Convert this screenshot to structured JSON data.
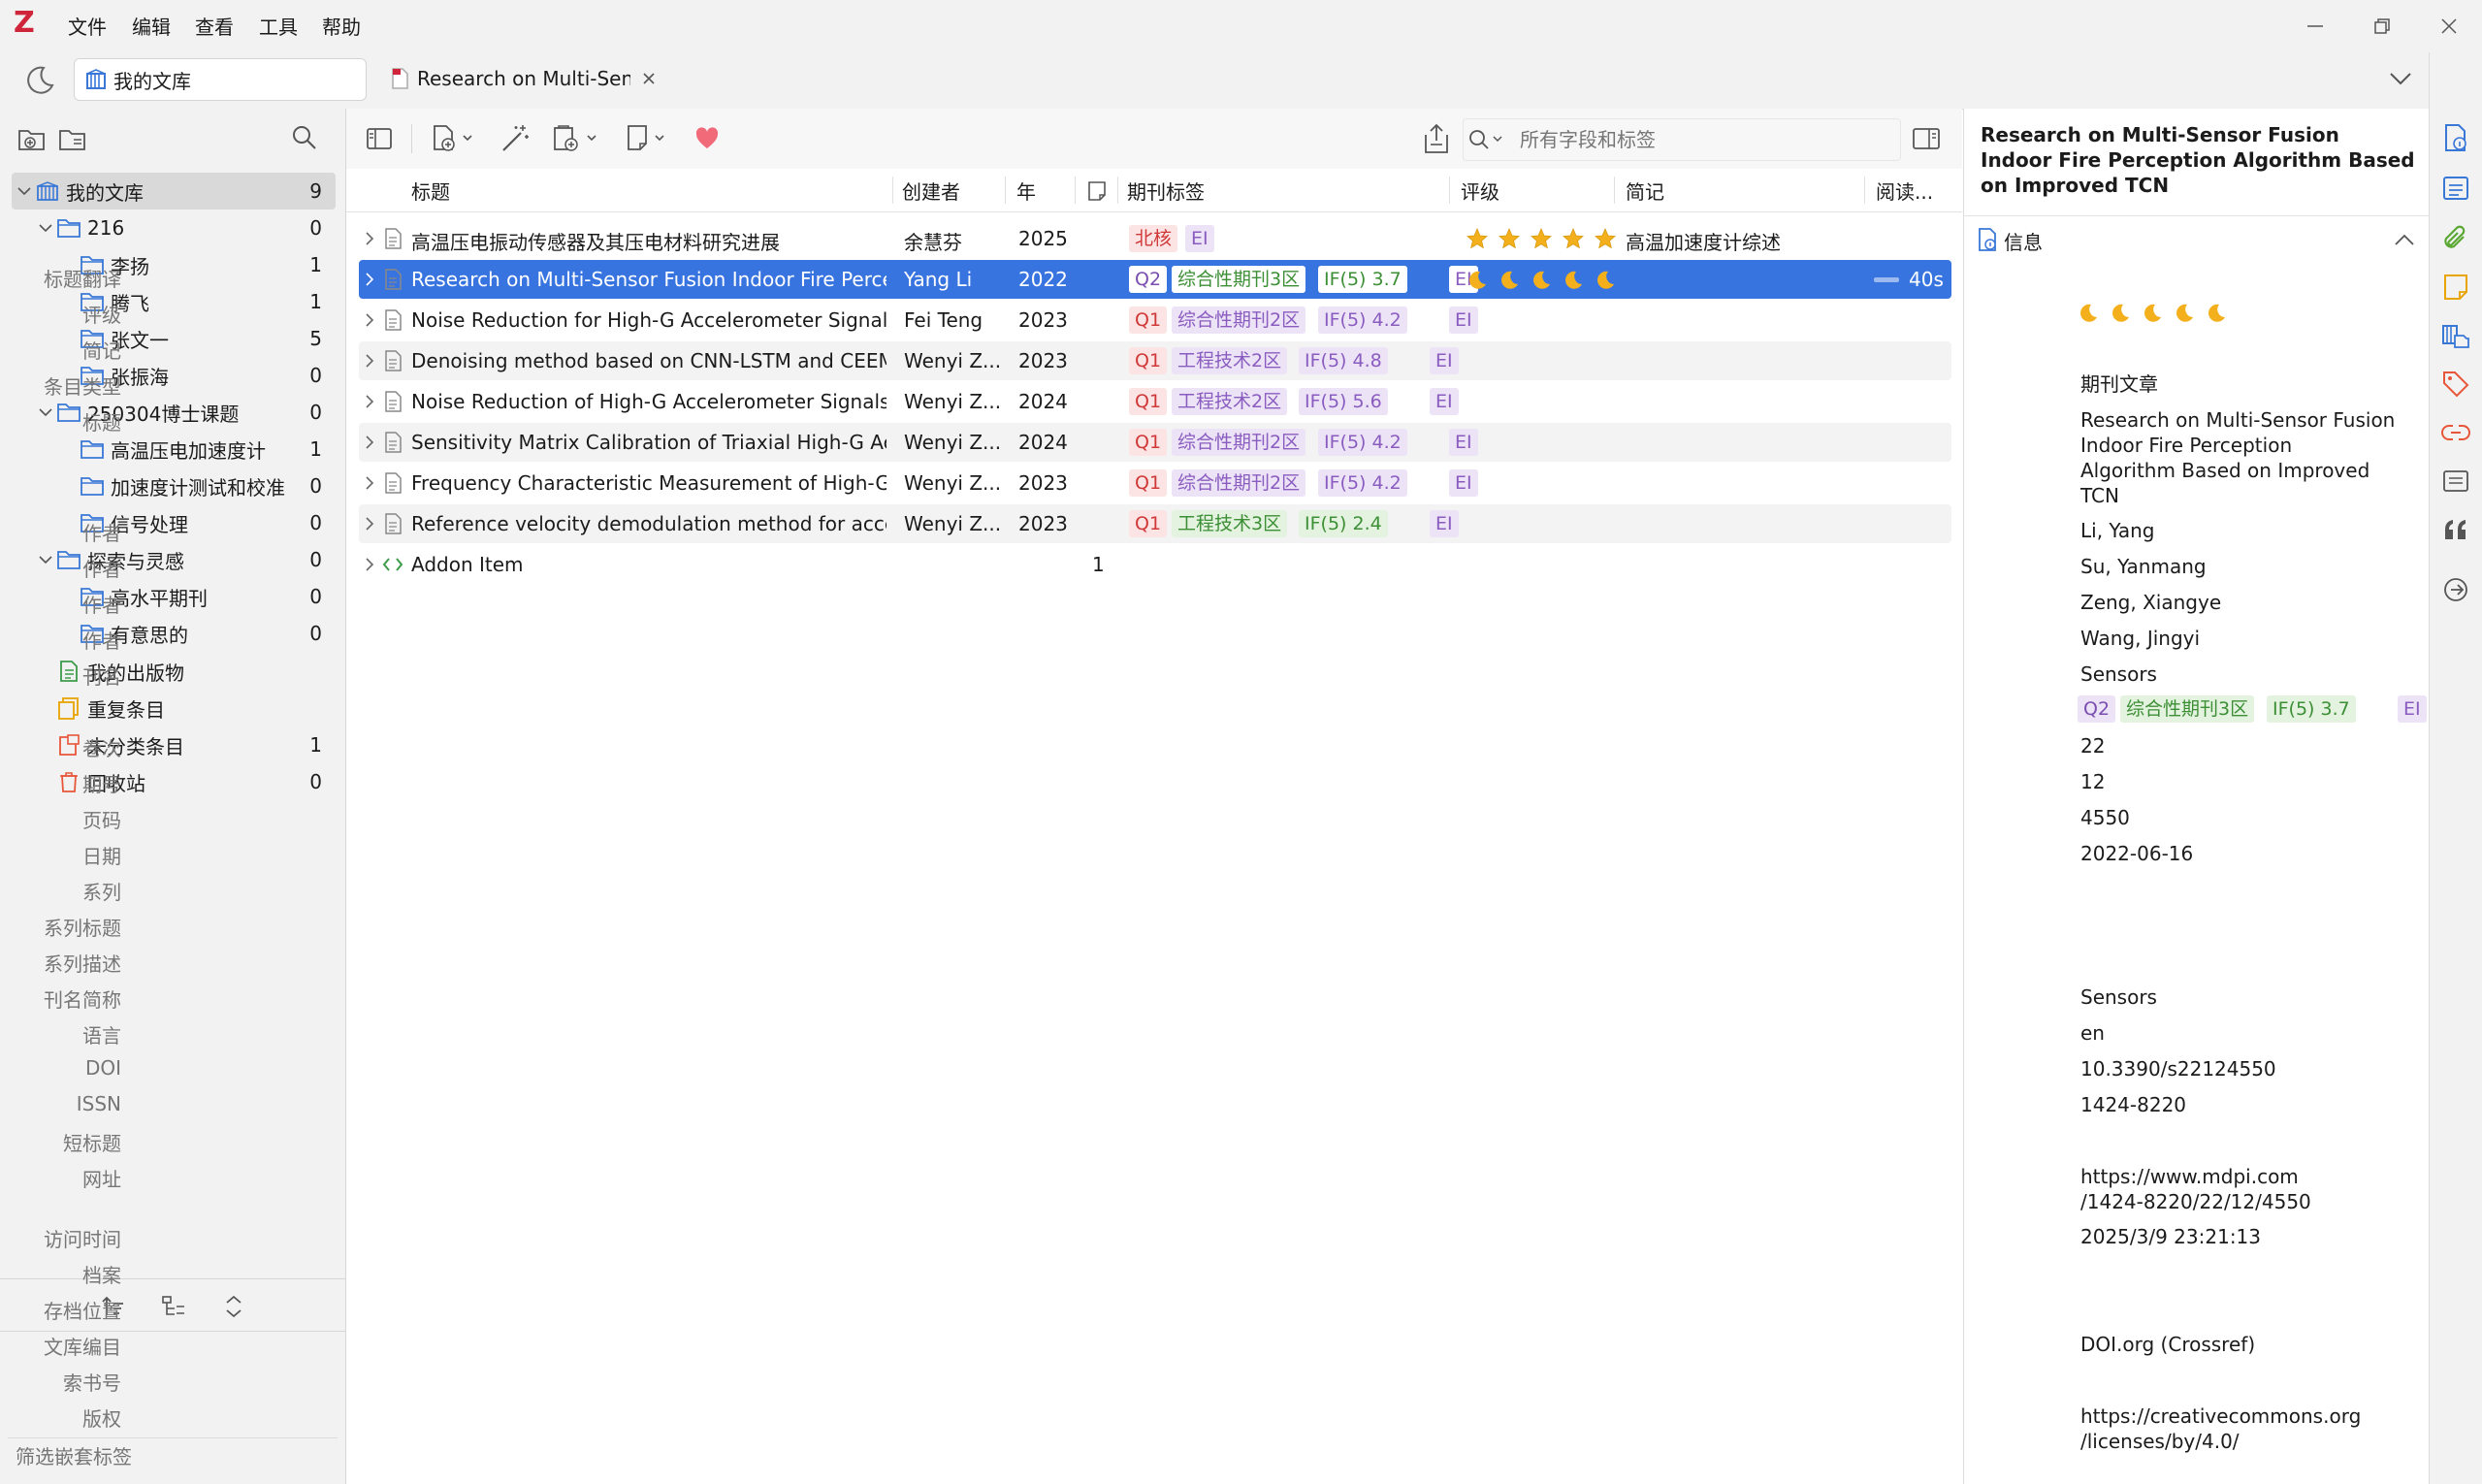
{
  "app": {
    "logo": "Z"
  },
  "menu": [
    "文件",
    "编辑",
    "查看",
    "工具",
    "帮助"
  ],
  "tabs": [
    {
      "label": "我的文库",
      "icon": "library-icon"
    },
    {
      "label": "Research on Multi-Sens",
      "icon": "pdf-icon"
    }
  ],
  "sidebar": {
    "collections": [
      {
        "name": "我的文库",
        "count": "9",
        "level": 0,
        "icon": "library-icon",
        "expanded": true,
        "selected": true
      },
      {
        "name": "216",
        "count": "0",
        "level": 1,
        "icon": "folder-icon",
        "expanded": true
      },
      {
        "name": "李扬",
        "count": "1",
        "level": 2,
        "icon": "folder-icon"
      },
      {
        "name": "腾飞",
        "count": "1",
        "level": 2,
        "icon": "folder-icon"
      },
      {
        "name": "张文一",
        "count": "5",
        "level": 2,
        "icon": "folder-icon"
      },
      {
        "name": "张振海",
        "count": "0",
        "level": 2,
        "icon": "folder-icon"
      },
      {
        "name": "250304博士课题",
        "count": "0",
        "level": 1,
        "icon": "folder-icon",
        "expanded": true
      },
      {
        "name": "高温压电加速度计",
        "count": "1",
        "level": 2,
        "icon": "folder-icon"
      },
      {
        "name": "加速度计测试和校准",
        "count": "0",
        "level": 2,
        "icon": "folder-icon"
      },
      {
        "name": "信号处理",
        "count": "0",
        "level": 2,
        "icon": "folder-icon"
      },
      {
        "name": "探索与灵感",
        "count": "0",
        "level": 1,
        "icon": "folder-icon",
        "expanded": true
      },
      {
        "name": "高水平期刊",
        "count": "0",
        "level": 2,
        "icon": "folder-icon"
      },
      {
        "name": "有意思的",
        "count": "0",
        "level": 2,
        "icon": "folder-icon"
      },
      {
        "name": "我的出版物",
        "count": "",
        "level": 1,
        "icon": "publications-icon"
      },
      {
        "name": "重复条目",
        "count": "",
        "level": 1,
        "icon": "duplicates-icon"
      },
      {
        "name": "未分类条目",
        "count": "1",
        "level": 1,
        "icon": "unfiled-icon"
      },
      {
        "name": "回收站",
        "count": "0",
        "level": 1,
        "icon": "trash-icon"
      }
    ],
    "tag_filter_placeholder": "筛选嵌套标签"
  },
  "toolbar": {
    "search_placeholder": "所有字段和标签"
  },
  "columns": {
    "title": "标题",
    "creator": "创建者",
    "year": "年",
    "journal_tags": "期刊标签",
    "rating": "评级",
    "extra": "简记",
    "reading": "阅读..."
  },
  "items": [
    {
      "title": "高温压电振动传感器及其压电材料研究进展",
      "creator": "余慧芬",
      "year": "2025",
      "tags": [
        {
          "text": "北核",
          "cls": "t-beihe"
        },
        {
          "text": "EI",
          "cls": "t-ei"
        }
      ],
      "rating": "stars",
      "extra": "高温加速度计综述",
      "reading": ""
    },
    {
      "title": "Research on Multi-Sensor Fusion Indoor Fire Percep",
      "creator": "Yang Li",
      "year": "2022",
      "tags": [
        {
          "text": "Q2",
          "cls": "t-q2"
        },
        {
          "text": "综合性期刊3区",
          "cls": "t-zh-green"
        },
        {
          "text": "IF(5) 3.7",
          "cls": "t-if-green"
        },
        {
          "text": "EI",
          "cls": "t-ei"
        }
      ],
      "rating": "moons",
      "extra": "",
      "reading": "40s",
      "selected": true
    },
    {
      "title": "Noise Reduction for High-G Accelerometer Signals U",
      "creator": "Fei Teng",
      "year": "2023",
      "tags": [
        {
          "text": "Q1",
          "cls": "t-q1"
        },
        {
          "text": "综合性期刊2区",
          "cls": "t-zh"
        },
        {
          "text": "IF(5) 4.2",
          "cls": "t-if"
        },
        {
          "text": "EI",
          "cls": "t-ei"
        }
      ],
      "rating": "",
      "extra": "",
      "reading": ""
    },
    {
      "title": "Denoising method based on CNN-LSTM and CEEMD",
      "creator": "Wenyi Z...",
      "year": "2023",
      "tags": [
        {
          "text": "Q1",
          "cls": "t-q1"
        },
        {
          "text": "工程技术2区",
          "cls": "t-zh"
        },
        {
          "text": "IF(5) 4.8",
          "cls": "t-if"
        },
        {
          "text": "EI",
          "cls": "t-ei"
        }
      ],
      "rating": "",
      "extra": "",
      "reading": ""
    },
    {
      "title": "Noise Reduction of High-G Accelerometer Signals B",
      "creator": "Wenyi Z...",
      "year": "2024",
      "tags": [
        {
          "text": "Q1",
          "cls": "t-q1"
        },
        {
          "text": "工程技术2区",
          "cls": "t-zh"
        },
        {
          "text": "IF(5) 5.6",
          "cls": "t-if"
        },
        {
          "text": "EI",
          "cls": "t-ei"
        }
      ],
      "rating": "",
      "extra": "",
      "reading": ""
    },
    {
      "title": "Sensitivity Matrix Calibration of Triaxial High-G Acce",
      "creator": "Wenyi Z...",
      "year": "2024",
      "tags": [
        {
          "text": "Q1",
          "cls": "t-q1"
        },
        {
          "text": "综合性期刊2区",
          "cls": "t-zh"
        },
        {
          "text": "IF(5) 4.2",
          "cls": "t-if"
        },
        {
          "text": "EI",
          "cls": "t-ei"
        }
      ],
      "rating": "",
      "extra": "",
      "reading": ""
    },
    {
      "title": "Frequency Characteristic Measurement of High-G Ac",
      "creator": "Wenyi Z...",
      "year": "2023",
      "tags": [
        {
          "text": "Q1",
          "cls": "t-q1"
        },
        {
          "text": "综合性期刊2区",
          "cls": "t-zh"
        },
        {
          "text": "IF(5) 4.2",
          "cls": "t-if"
        },
        {
          "text": "EI",
          "cls": "t-ei"
        }
      ],
      "rating": "",
      "extra": "",
      "reading": ""
    },
    {
      "title": "Reference velocity demodulation method for accele",
      "creator": "Wenyi Z...",
      "year": "2023",
      "tags": [
        {
          "text": "Q1",
          "cls": "t-q1"
        },
        {
          "text": "工程技术3区",
          "cls": "t-zh-green"
        },
        {
          "text": "IF(5) 2.4",
          "cls": "t-if-green"
        },
        {
          "text": "EI",
          "cls": "t-ei"
        }
      ],
      "rating": "",
      "extra": "",
      "reading": ""
    },
    {
      "title": "Addon Item",
      "creator": "",
      "year": "",
      "tags": [],
      "rating": "",
      "extra": "",
      "reading": "",
      "notes": "1",
      "addon": true
    }
  ],
  "details": {
    "title": "Research on Multi-Sensor Fusion Indoor Fire Perception Algorithm Based on Improved TCN",
    "section_label": "信息",
    "fields": [
      {
        "label": "标题翻译",
        "value": ""
      },
      {
        "label": "评级",
        "value": "",
        "moons": true
      },
      {
        "label": "简记",
        "value": ""
      },
      {
        "label": "条目类型",
        "value": "期刊文章"
      },
      {
        "label": "标题",
        "value": "Research on Multi-Sensor Fusion\nIndoor Fire Perception\nAlgorithm Based on Improved\nTCN"
      },
      {
        "label": "作者",
        "value": "Li, Yang"
      },
      {
        "label": "作者",
        "value": "Su, Yanmang"
      },
      {
        "label": "作者",
        "value": "Zeng, Xiangye"
      },
      {
        "label": "作者",
        "value": "Wang, Jingyi"
      },
      {
        "label": "刊名",
        "value": "Sensors"
      },
      {
        "label": "",
        "value": "",
        "tags": [
          {
            "text": "Q2",
            "cls": "t-q2"
          },
          {
            "text": "综合性期刊3区",
            "cls": "t-zh-green"
          },
          {
            "text": "IF(5) 3.7",
            "cls": "t-if-green"
          },
          {
            "text": "EI",
            "cls": "t-ei"
          }
        ]
      },
      {
        "label": "卷次",
        "value": "22"
      },
      {
        "label": "期号",
        "value": "12"
      },
      {
        "label": "页码",
        "value": "4550"
      },
      {
        "label": "日期",
        "value": "2022-06-16"
      },
      {
        "label": "系列",
        "value": ""
      },
      {
        "label": "系列标题",
        "value": ""
      },
      {
        "label": "系列描述",
        "value": ""
      },
      {
        "label": "刊名简称",
        "value": "Sensors"
      },
      {
        "label": "语言",
        "value": "en"
      },
      {
        "label": "DOI",
        "value": "10.3390/s22124550"
      },
      {
        "label": "ISSN",
        "value": "1424-8220"
      },
      {
        "label": "短标题",
        "value": ""
      },
      {
        "label": "网址",
        "value": "https://www.mdpi.com\n/1424-8220/22/12/4550"
      },
      {
        "label": "访问时间",
        "value": "2025/3/9 23:21:13"
      },
      {
        "label": "档案",
        "value": ""
      },
      {
        "label": "存档位置",
        "value": ""
      },
      {
        "label": "文库编目",
        "value": "DOI.org (Crossref)"
      },
      {
        "label": "索书号",
        "value": ""
      },
      {
        "label": "版权",
        "value": "https://creativecommons.org\n/licenses/by/4.0/"
      }
    ]
  },
  "colors": {
    "accent": "#3874e0",
    "logo": "#d0243a",
    "folder": "#3a78d8"
  }
}
